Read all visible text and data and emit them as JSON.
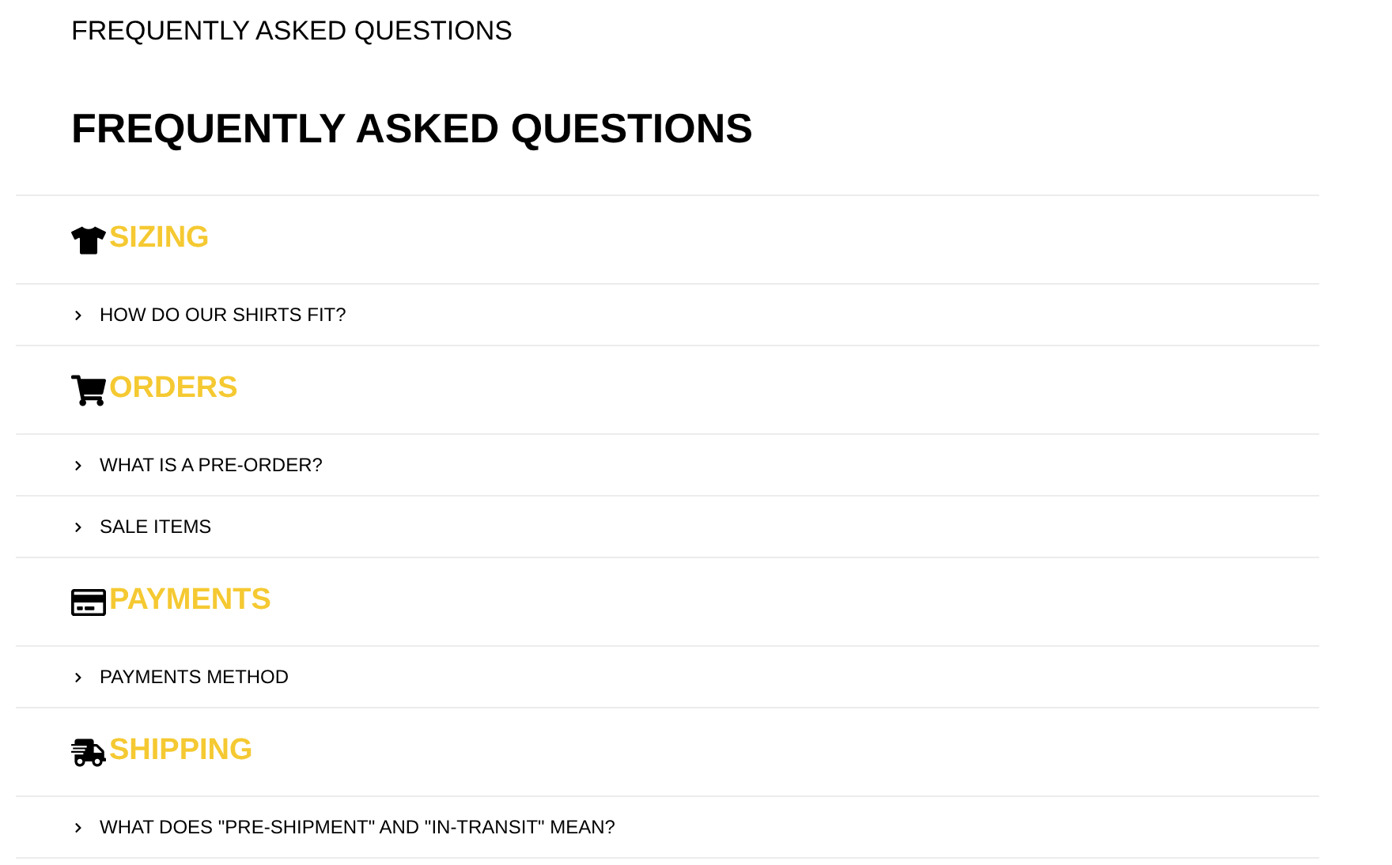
{
  "breadcrumb": "FREQUENTLY ASKED QUESTIONS",
  "title": "FREQUENTLY ASKED QUESTIONS",
  "sections": [
    {
      "kind": "shirt",
      "title": "SIZING",
      "questions": [
        {
          "text": "HOW DO OUR SHIRTS FIT?",
          "expanded": false
        }
      ]
    },
    {
      "kind": "cart",
      "title": "ORDERS",
      "questions": [
        {
          "text": "WHAT IS A PRE-ORDER?",
          "expanded": false
        },
        {
          "text": "SALE ITEMS",
          "expanded": false
        }
      ]
    },
    {
      "kind": "card",
      "title": "PAYMENTS",
      "questions": [
        {
          "text": "PAYMENTS METHOD",
          "expanded": false
        }
      ]
    },
    {
      "kind": "truck",
      "title": "SHIPPING",
      "questions": [
        {
          "text": "WHAT DOES \"PRE-SHIPMENT\" AND \"IN-TRANSIT\" MEAN?",
          "expanded": false
        }
      ]
    }
  ]
}
